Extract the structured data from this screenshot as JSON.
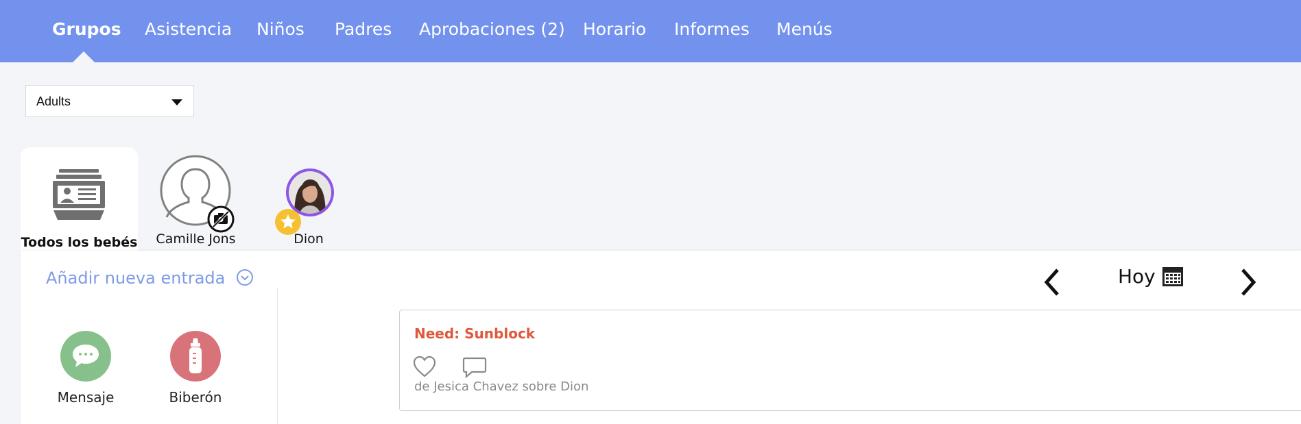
{
  "nav": {
    "items": [
      {
        "label": "Grupos",
        "active": true
      },
      {
        "label": "Asistencia"
      },
      {
        "label": "Niños"
      },
      {
        "label": "Padres"
      },
      {
        "label": "Aprobaciones (2)"
      },
      {
        "label": "Horario"
      },
      {
        "label": "Informes"
      },
      {
        "label": "Menús"
      }
    ]
  },
  "group_select": {
    "value": "Adults"
  },
  "children": [
    {
      "label": "Todos los bebés",
      "icon": "all-babies-icon",
      "selected": true
    },
    {
      "label": "Camille Jons",
      "icon": "default-avatar-icon",
      "badge": "no-photo-icon"
    },
    {
      "label": "Dion",
      "icon": "photo-avatar",
      "badge": "star-badge-icon"
    }
  ],
  "entry": {
    "add_label": "Añadir nueva entrada",
    "actions": [
      {
        "label": "Mensaje",
        "icon": "chat-bubble-icon",
        "color": "#86c08a"
      },
      {
        "label": "Biberón",
        "icon": "baby-bottle-icon",
        "color": "#d9737a"
      }
    ]
  },
  "date_nav": {
    "label": "Hoy"
  },
  "feed": {
    "card": {
      "title": "Need: Sunblock",
      "meta": "de Jesica Chavez sobre Dion"
    }
  },
  "colors": {
    "nav_bg": "#7292ee",
    "accent_link": "#7d9be6",
    "need_title": "#e0583a",
    "star_badge": "#f5c132",
    "avatar_ring": "#8e55e6"
  }
}
